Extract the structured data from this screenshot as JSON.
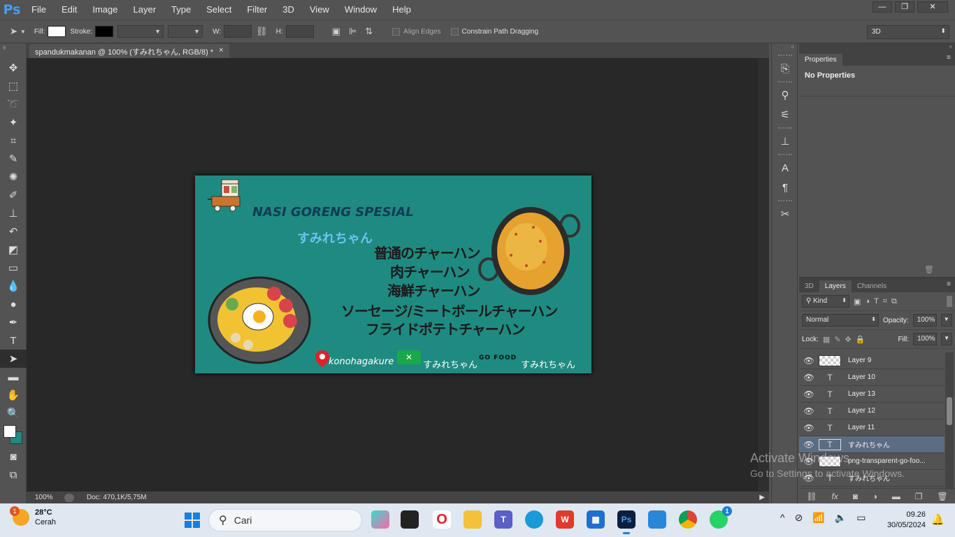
{
  "menu": [
    "File",
    "Edit",
    "Image",
    "Layer",
    "Type",
    "Select",
    "Filter",
    "3D",
    "View",
    "Window",
    "Help"
  ],
  "app_logo": "Ps",
  "window_controls": [
    "—",
    "❐",
    "✕"
  ],
  "options": {
    "fill_label": "Fill:",
    "stroke_label": "Stroke:",
    "w_label": "W:",
    "h_label": "H:",
    "align_edges": "Align Edges",
    "constrain": "Constrain Path Dragging",
    "workspace": "3D"
  },
  "document": {
    "tab_title": "spandukmakanan @ 100% (すみれちゃん, RGB/8) *",
    "tab_close": "×",
    "zoom": "100%",
    "doc_size": "Doc: 470,1K/5,75M"
  },
  "banner": {
    "title": "NASI GORENG SPESIAL",
    "subtitle": "すみれちゃん",
    "menu_lines": [
      "普通のチャーハン",
      "肉チャーハン",
      "海鮮チャーハン",
      "ソーセージ/ミートボールチャーハン",
      "フライドポテトチャーハン"
    ],
    "location": "konohagakure",
    "shop1": "すみれちゃん",
    "gofood_logo": "GO FOOD",
    "shop2": "すみれちゃん",
    "bg_color": "#1f8a80"
  },
  "properties": {
    "tab": "Properties",
    "body": "No Properties"
  },
  "layers": {
    "tabs": [
      "3D",
      "Layers",
      "Channels"
    ],
    "active_tab": "Layers",
    "filter": "Kind",
    "blend": "Normal",
    "opacity_label": "Opacity:",
    "opacity": "100%",
    "lock_label": "Lock:",
    "fill_label": "Fill:",
    "fill": "100%",
    "items": [
      {
        "name": "Layer 9",
        "type": "image"
      },
      {
        "name": "Layer 10",
        "type": "text"
      },
      {
        "name": "Layer 13",
        "type": "text"
      },
      {
        "name": "Layer 12",
        "type": "text"
      },
      {
        "name": "Layer 11",
        "type": "text"
      },
      {
        "name": "すみれちゃん",
        "type": "text",
        "selected": true
      },
      {
        "name": "png-transparent-go-foo...",
        "type": "image"
      },
      {
        "name": "すみれちゃん",
        "type": "text"
      }
    ]
  },
  "watermark": {
    "line1": "Activate Windows",
    "line2": "Go to Settings to activate Windows."
  },
  "taskbar": {
    "temp": "28°C",
    "weather": "Cerah",
    "weather_badge": "1",
    "search_placeholder": "Cari",
    "whatsapp_badge": "1",
    "time": "09.26",
    "date": "30/05/2024"
  }
}
